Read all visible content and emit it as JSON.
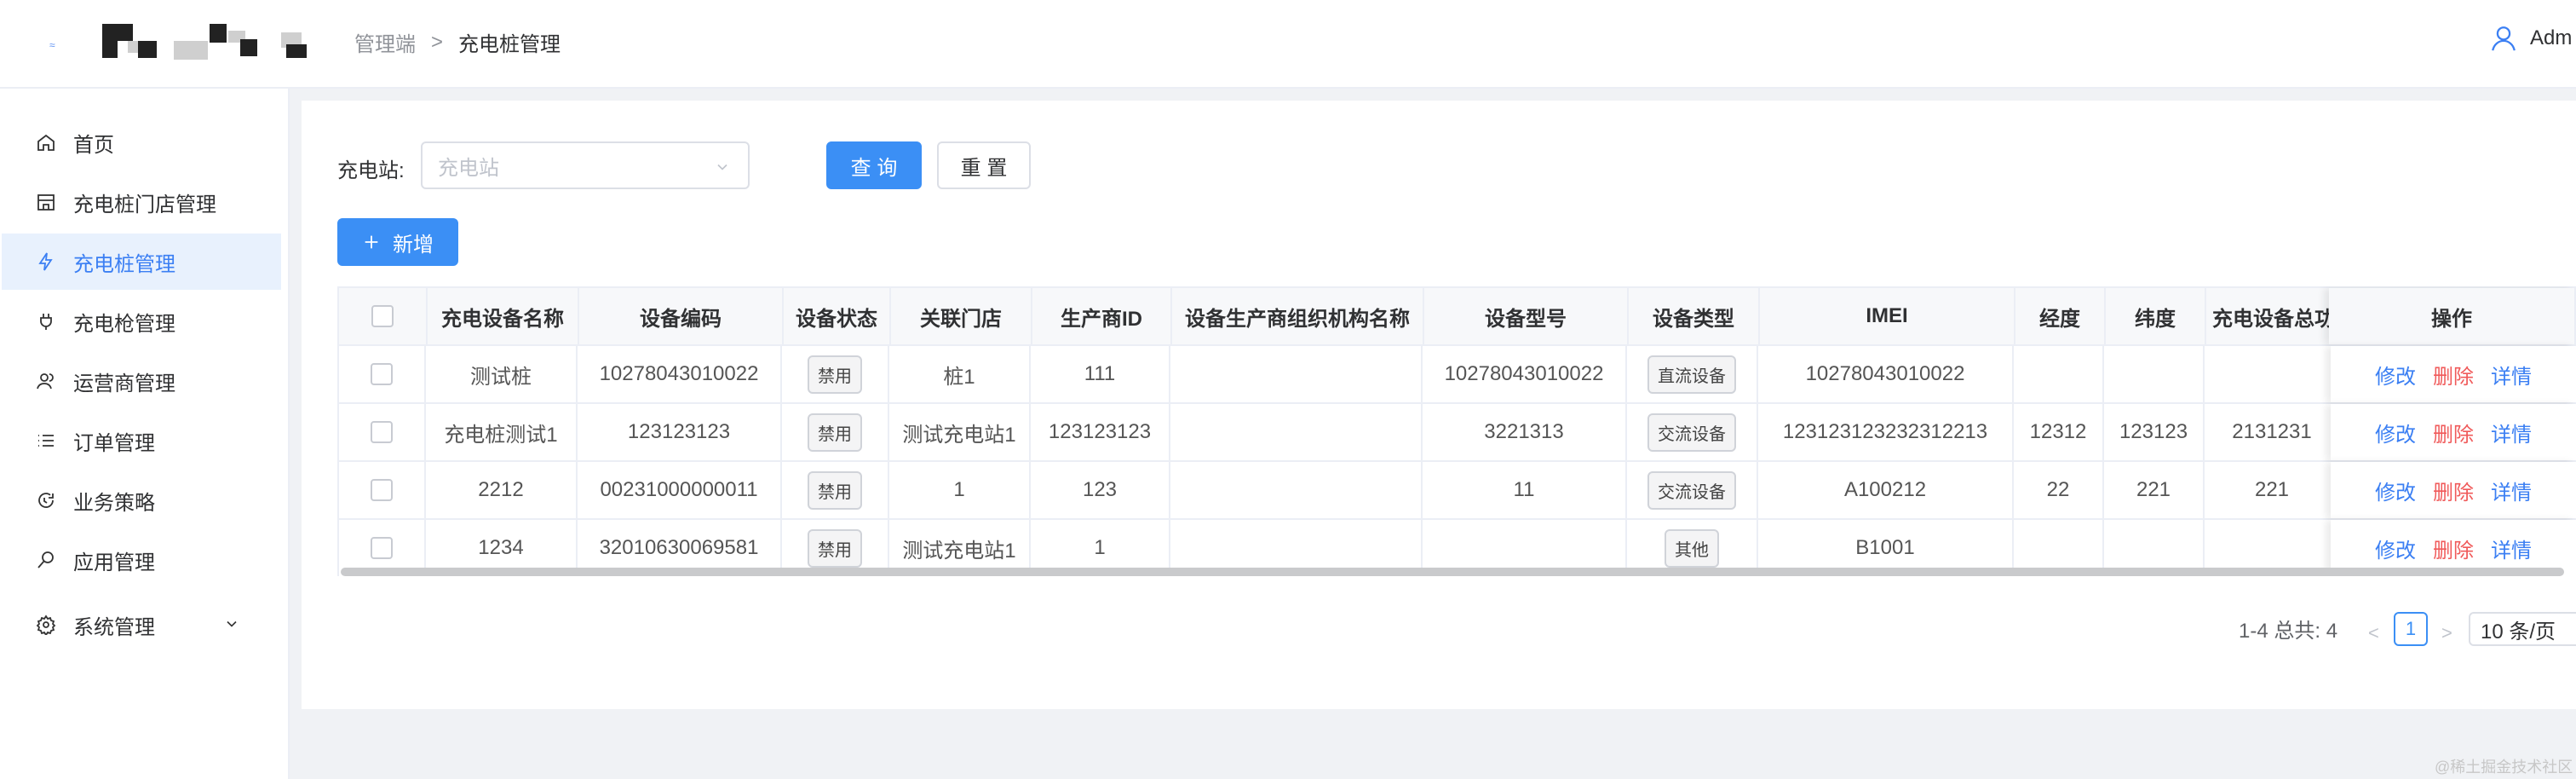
{
  "header": {
    "breadcrumb": [
      "管理端",
      ">",
      "充电桩管理"
    ],
    "user_name": "Adm"
  },
  "sidebar": {
    "items": [
      {
        "label": "首页",
        "icon": "home-icon"
      },
      {
        "label": "充电桩门店管理",
        "icon": "store-icon"
      },
      {
        "label": "充电桩管理",
        "icon": "lightning-icon",
        "active": true
      },
      {
        "label": "充电枪管理",
        "icon": "plug-icon"
      },
      {
        "label": "运营商管理",
        "icon": "people-icon"
      },
      {
        "label": "订单管理",
        "icon": "list-icon"
      },
      {
        "label": "业务策略",
        "icon": "refresh-icon"
      },
      {
        "label": "应用管理",
        "icon": "key-icon"
      },
      {
        "label": "系统管理",
        "icon": "gear-icon"
      }
    ]
  },
  "filter": {
    "label": "充电站:",
    "placeholder": "充电站",
    "query_label": "查 询",
    "reset_label": "重 置",
    "add_label": "新增"
  },
  "table": {
    "columns": [
      "充电设备名称",
      "设备编码",
      "设备状态",
      "关联门店",
      "生产商ID",
      "设备生产商组织机构名称",
      "设备型号",
      "设备类型",
      "IMEI",
      "经度",
      "纬度",
      "充电设备总功"
    ],
    "ops_header": "操作",
    "ops": {
      "edit": "修改",
      "delete": "删除",
      "detail": "详情"
    },
    "rows": [
      [
        "测试桩",
        "10278043010022",
        "禁用",
        "桩1",
        "111",
        "",
        "10278043010022",
        "直流设备",
        "10278043010022",
        "",
        "",
        ""
      ],
      [
        "充电桩测试1",
        "123123123",
        "禁用",
        "测试充电站1",
        "123123123",
        "",
        "3221313",
        "交流设备",
        "123123123232312213",
        "12312",
        "123123",
        "2131231"
      ],
      [
        "2212",
        "00231000000011",
        "禁用",
        "1",
        "123",
        "",
        "11",
        "交流设备",
        "A100212",
        "22",
        "221",
        "221"
      ],
      [
        "1234",
        "32010630069581",
        "禁用",
        "测试充电站1",
        "1",
        "",
        "",
        "其他",
        "B1001",
        "",
        "",
        ""
      ]
    ]
  },
  "pagination": {
    "summary": "1-4 总共: 4",
    "current_page": "1",
    "page_size": "10 条/页"
  },
  "watermark": "@稀土掘金技术社区"
}
